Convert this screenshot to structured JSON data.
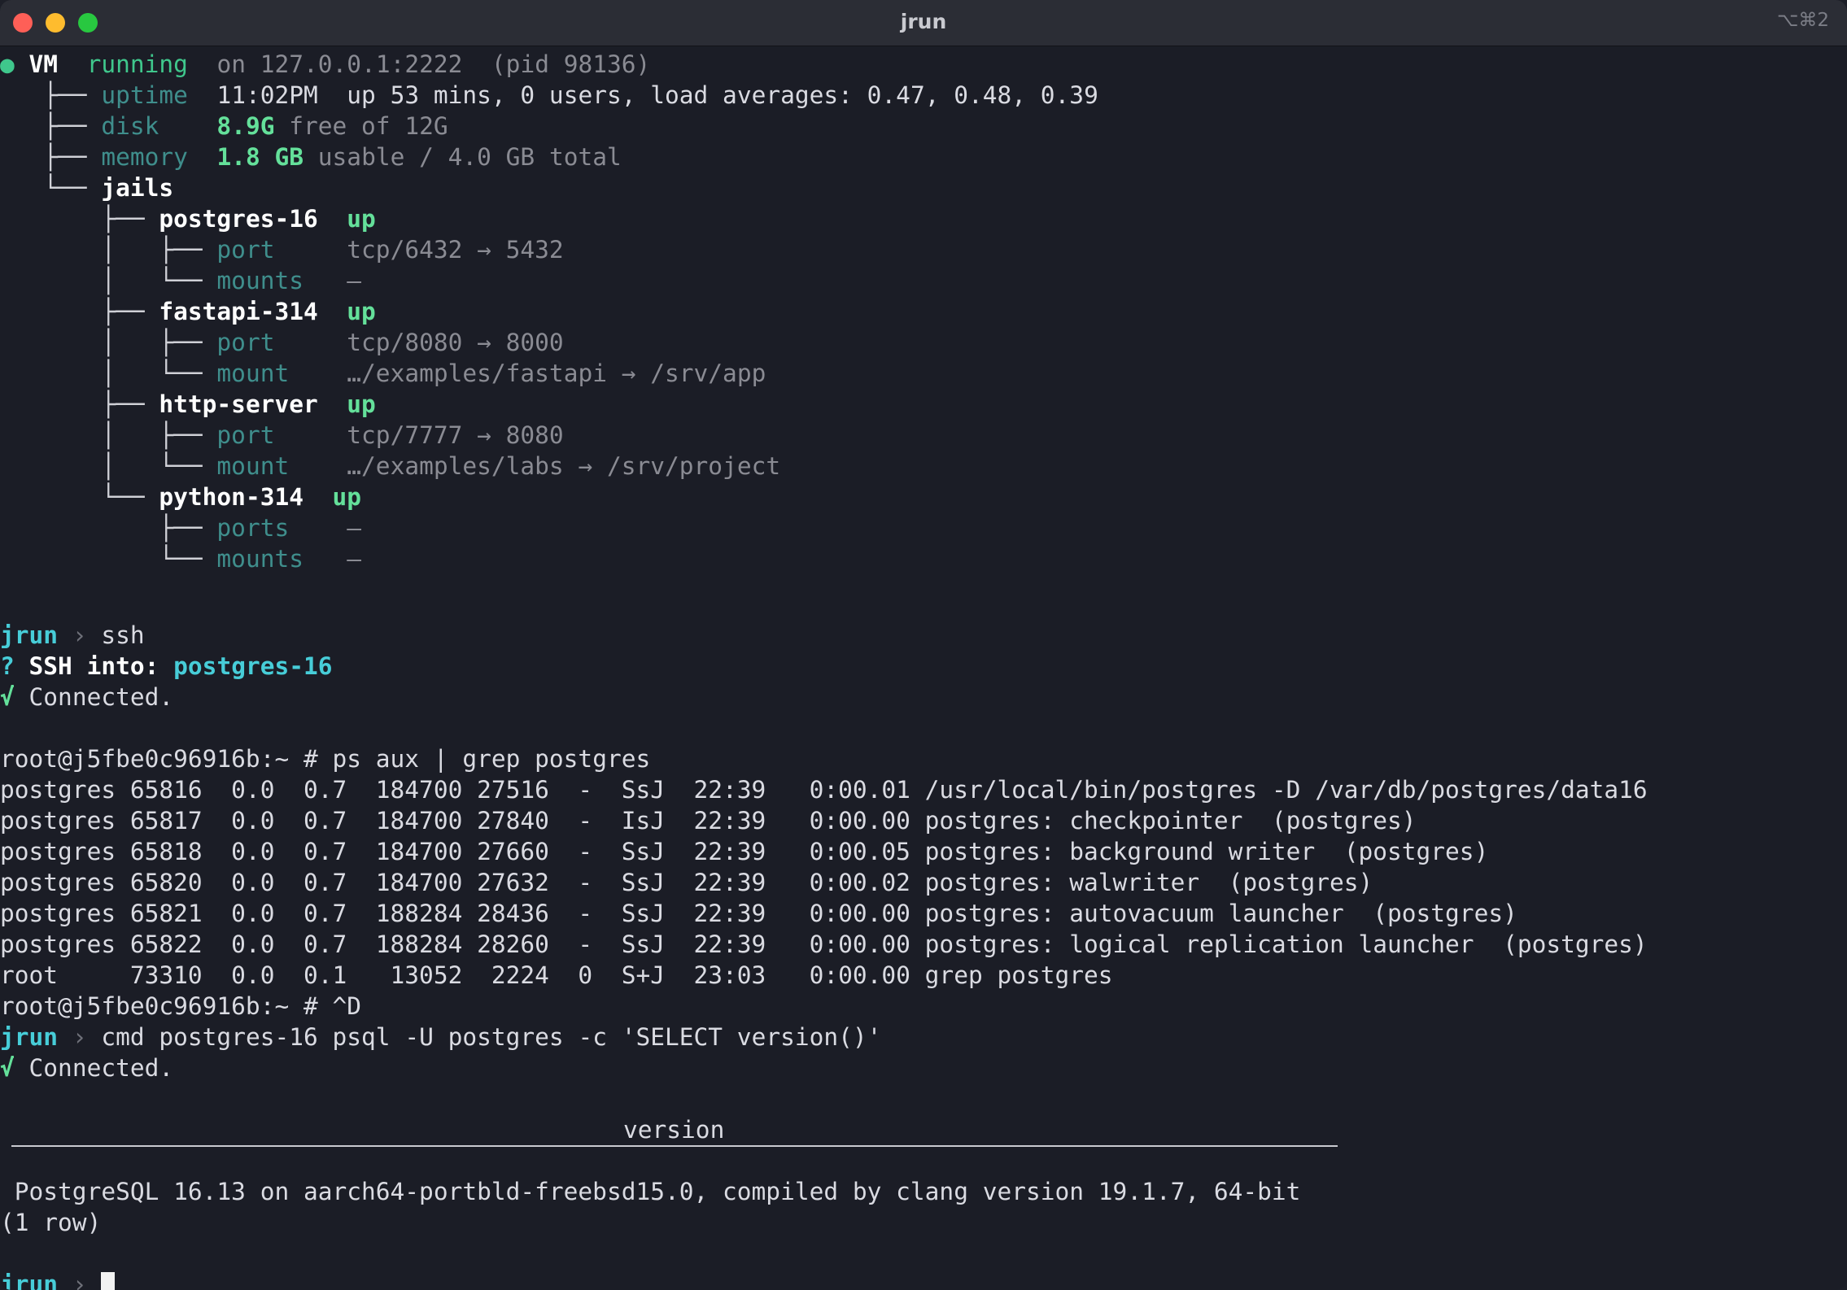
{
  "window": {
    "title": "jrun",
    "shortcut": "⌥⌘2"
  },
  "vm": {
    "bullet": "●",
    "label": "VM",
    "state": "running",
    "address": "on 127.0.0.1:2222",
    "pid": "(pid 98136)",
    "uptime_key": "uptime",
    "uptime_value": "11:02PM  up 53 mins, 0 users, load averages: 0.47, 0.48, 0.39",
    "disk_key": "disk",
    "disk_value": "8.9G",
    "disk_rest": "free of 12G",
    "memory_key": "memory",
    "memory_value": "1.8 GB",
    "memory_rest": "usable / 4.0 GB total",
    "jails_key": "jails"
  },
  "jails": [
    {
      "name": "postgres-16",
      "status": "up",
      "k1": "port",
      "v1": "tcp/6432 → 5432",
      "k2": "mounts",
      "v2": "—"
    },
    {
      "name": "fastapi-314",
      "status": "up",
      "k1": "port",
      "v1": "tcp/8080 → 8000",
      "k2": "mount",
      "v2": "…/examples/fastapi → /srv/app"
    },
    {
      "name": "http-server",
      "status": "up",
      "k1": "port",
      "v1": "tcp/7777 → 8080",
      "k2": "mount",
      "v2": "…/examples/labs → /srv/project"
    },
    {
      "name": "python-314",
      "status": "up",
      "k1": "ports",
      "v1": "—",
      "k2": "mounts",
      "v2": "—"
    }
  ],
  "session": {
    "prompt": "jrun",
    "prompt_arrow": "›",
    "cmd1": "ssh",
    "q_mark": "?",
    "ssh_label": "SSH into:",
    "ssh_target": "postgres-16",
    "check": "√",
    "connected": "Connected.",
    "root_prompt": "root@j5fbe0c96916b:~ #",
    "ps_cmd": "ps aux | grep postgres",
    "ps_rows": [
      "postgres 65816  0.0  0.7  184700 27516  -  SsJ  22:39   0:00.01 /usr/local/bin/postgres -D /var/db/postgres/data16",
      "postgres 65817  0.0  0.7  184700 27840  -  IsJ  22:39   0:00.00 postgres: checkpointer  (postgres)",
      "postgres 65818  0.0  0.7  184700 27660  -  SsJ  22:39   0:00.05 postgres: background writer  (postgres)",
      "postgres 65820  0.0  0.7  184700 27632  -  SsJ  22:39   0:00.02 postgres: walwriter  (postgres)",
      "postgres 65821  0.0  0.7  188284 28436  -  SsJ  22:39   0:00.00 postgres: autovacuum launcher  (postgres)",
      "postgres 65822  0.0  0.7  188284 28260  -  SsJ  22:39   0:00.00 postgres: logical replication launcher  (postgres)",
      "root     73310  0.0  0.1   13052  2224  0  S+J  23:03   0:00.00 grep postgres"
    ],
    "eof_cmd": "^D",
    "cmd2": "cmd postgres-16 psql -U postgres -c 'SELECT version()'",
    "psql_header": "version",
    "psql_value": " PostgreSQL 16.13 on aarch64-portbld-freebsd15.0, compiled by clang version 19.1.7, 64-bit",
    "psql_rows": "(1 row)"
  }
}
